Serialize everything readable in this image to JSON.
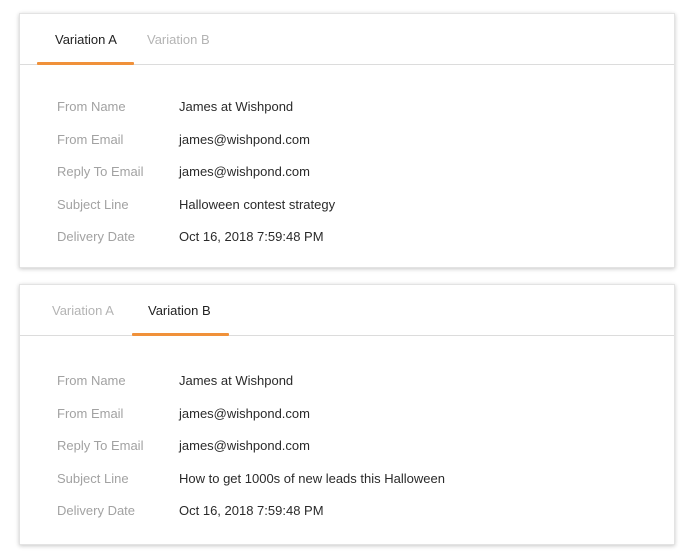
{
  "colors": {
    "accent": "#f0913a",
    "label_text": "#a2a2a2",
    "value_text": "#2a2a2a",
    "inactive_tab": "#b4b4b4"
  },
  "cards": [
    {
      "tabs": [
        {
          "label": "Variation A",
          "active": true
        },
        {
          "label": "Variation B",
          "active": false
        }
      ],
      "fields": [
        {
          "label": "From Name",
          "value": "James at Wishpond"
        },
        {
          "label": "From Email",
          "value": "james@wishpond.com"
        },
        {
          "label": "Reply To Email",
          "value": "james@wishpond.com"
        },
        {
          "label": "Subject Line",
          "value": "Halloween contest strategy"
        },
        {
          "label": "Delivery Date",
          "value": "Oct 16, 2018 7:59:48 PM"
        }
      ]
    },
    {
      "tabs": [
        {
          "label": "Variation A",
          "active": false
        },
        {
          "label": "Variation B",
          "active": true
        }
      ],
      "fields": [
        {
          "label": "From Name",
          "value": "James at Wishpond"
        },
        {
          "label": "From Email",
          "value": "james@wishpond.com"
        },
        {
          "label": "Reply To Email",
          "value": "james@wishpond.com"
        },
        {
          "label": "Subject Line",
          "value": "How to get 1000s of new leads this Halloween"
        },
        {
          "label": "Delivery Date",
          "value": "Oct 16, 2018 7:59:48 PM"
        }
      ]
    }
  ]
}
